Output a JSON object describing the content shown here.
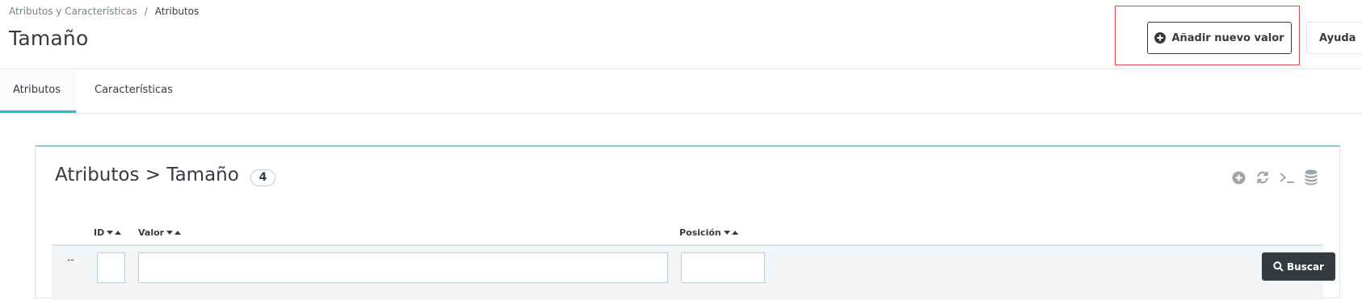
{
  "breadcrumb": {
    "parent": "Atributos y Características",
    "separator": "/",
    "current": "Atributos"
  },
  "page": {
    "title": "Tamaño"
  },
  "toolbar": {
    "add_label": "Añadir nuevo valor",
    "help_label": "Ayuda"
  },
  "tabs": [
    {
      "label": "Atributos",
      "active": true
    },
    {
      "label": "Características",
      "active": false
    }
  ],
  "panel": {
    "title": "Atributos > Tamaño",
    "count": "4",
    "tools": [
      "add-icon",
      "refresh-icon",
      "sql-terminal-icon",
      "database-icon"
    ]
  },
  "table": {
    "columns": [
      {
        "label": "ID",
        "sortable": true
      },
      {
        "label": "Valor",
        "sortable": true
      },
      {
        "label": "Posición",
        "sortable": true
      }
    ],
    "filter_row": {
      "bulk_placeholder": "--",
      "id_value": "",
      "valor_value": "",
      "position_value": "",
      "search_label": "Buscar"
    }
  },
  "colors": {
    "accent": "#25b9d7",
    "highlight": "#e0474c",
    "dark": "#363a41"
  }
}
